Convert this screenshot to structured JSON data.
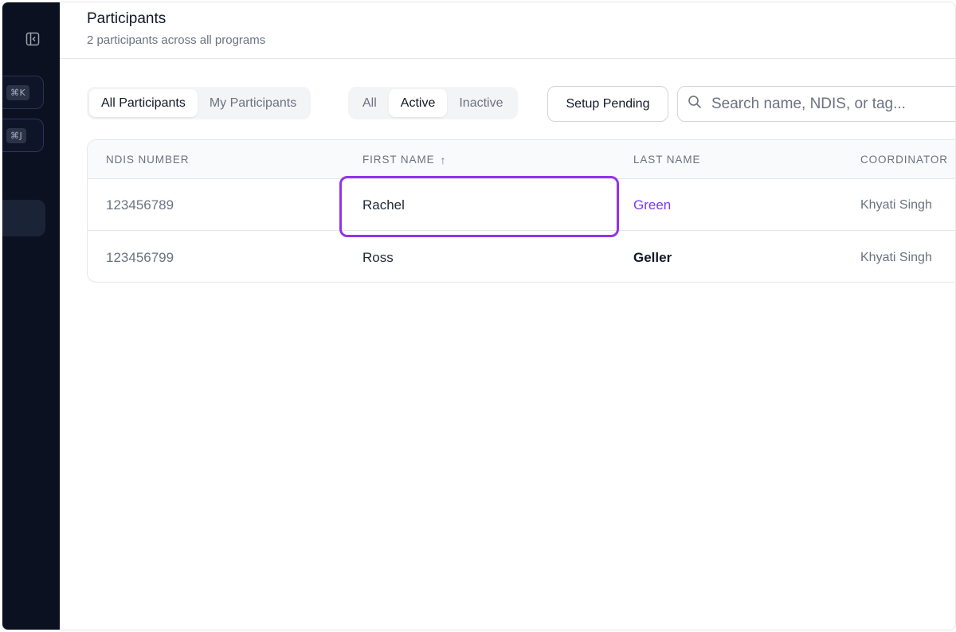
{
  "sidebar": {
    "collapse_icon": "sidebar-collapse-icon",
    "shortcut_k": "⌘K",
    "shortcut_j": "⌘J"
  },
  "header": {
    "title": "Participants",
    "subtitle": "2 participants across all programs"
  },
  "filters": {
    "scope": {
      "options": [
        "All Participants",
        "My Participants"
      ],
      "selected": "All Participants"
    },
    "status": {
      "options": [
        "All",
        "Active",
        "Inactive"
      ],
      "selected": "Active"
    },
    "setup_pending_label": "Setup Pending",
    "search": {
      "placeholder": "Search name, NDIS, or tag...",
      "value": ""
    }
  },
  "table": {
    "columns": [
      "NDIS NUMBER",
      "FIRST NAME",
      "LAST NAME",
      "COORDINATOR"
    ],
    "sort_indicator": "↑",
    "rows": [
      {
        "ndis": "123456789",
        "first": "Rachel",
        "last": "Green",
        "coordinator": "Khyati Singh"
      },
      {
        "ndis": "123456799",
        "first": "Ross",
        "last": "Geller",
        "coordinator": "Khyati Singh"
      }
    ]
  },
  "colors": {
    "sidebar_bg": "#0b1120",
    "accent": "#7c3aed",
    "highlight": "#9333ea"
  }
}
